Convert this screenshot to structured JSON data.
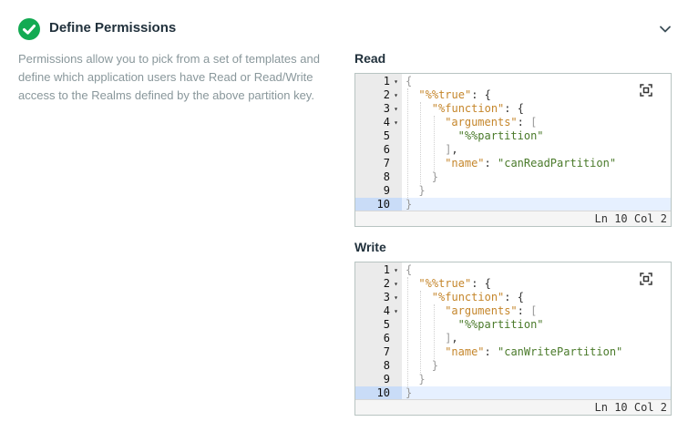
{
  "header": {
    "title": "Define Permissions"
  },
  "description": "Permissions allow you to pick from a set of templates and define which application users have Read or Read/Write access to the Realms defined by the above partition key.",
  "read": {
    "label": "Read",
    "status": "Ln 10 Col 2",
    "lines": [
      {
        "n": "1",
        "fold": true,
        "tokens": [
          [
            "p",
            "{"
          ]
        ]
      },
      {
        "n": "2",
        "fold": true,
        "tokens": [
          [
            "k",
            "\"%%true\""
          ],
          [
            "t",
            ": {"
          ]
        ]
      },
      {
        "n": "3",
        "fold": true,
        "tokens": [
          [
            "k",
            "\"%function\""
          ],
          [
            "t",
            ": {"
          ]
        ]
      },
      {
        "n": "4",
        "fold": true,
        "tokens": [
          [
            "k",
            "\"arguments\""
          ],
          [
            "t",
            ": "
          ],
          [
            "p",
            "["
          ]
        ]
      },
      {
        "n": "5",
        "fold": false,
        "tokens": [
          [
            "s",
            "\"%%partition\""
          ]
        ]
      },
      {
        "n": "6",
        "fold": false,
        "tokens": [
          [
            "p",
            "]"
          ],
          [
            "t",
            ","
          ]
        ]
      },
      {
        "n": "7",
        "fold": false,
        "tokens": [
          [
            "k",
            "\"name\""
          ],
          [
            "t",
            ": "
          ],
          [
            "s",
            "\"canReadPartition\""
          ]
        ]
      },
      {
        "n": "8",
        "fold": false,
        "tokens": [
          [
            "p",
            "}"
          ]
        ]
      },
      {
        "n": "9",
        "fold": false,
        "tokens": [
          [
            "p",
            "}"
          ]
        ]
      },
      {
        "n": "10",
        "fold": false,
        "tokens": [
          [
            "p",
            "}"
          ]
        ]
      }
    ]
  },
  "write": {
    "label": "Write",
    "status": "Ln 10 Col 2",
    "lines": [
      {
        "n": "1",
        "fold": true,
        "tokens": [
          [
            "p",
            "{"
          ]
        ]
      },
      {
        "n": "2",
        "fold": true,
        "tokens": [
          [
            "k",
            "\"%%true\""
          ],
          [
            "t",
            ": {"
          ]
        ]
      },
      {
        "n": "3",
        "fold": true,
        "tokens": [
          [
            "k",
            "\"%function\""
          ],
          [
            "t",
            ": {"
          ]
        ]
      },
      {
        "n": "4",
        "fold": true,
        "tokens": [
          [
            "k",
            "\"arguments\""
          ],
          [
            "t",
            ": "
          ],
          [
            "p",
            "["
          ]
        ]
      },
      {
        "n": "5",
        "fold": false,
        "tokens": [
          [
            "s",
            "\"%%partition\""
          ]
        ]
      },
      {
        "n": "6",
        "fold": false,
        "tokens": [
          [
            "p",
            "]"
          ],
          [
            "t",
            ","
          ]
        ]
      },
      {
        "n": "7",
        "fold": false,
        "tokens": [
          [
            "k",
            "\"name\""
          ],
          [
            "t",
            ": "
          ],
          [
            "s",
            "\"canWritePartition\""
          ]
        ]
      },
      {
        "n": "8",
        "fold": false,
        "tokens": [
          [
            "p",
            "}"
          ]
        ]
      },
      {
        "n": "9",
        "fold": false,
        "tokens": [
          [
            "p",
            "}"
          ]
        ]
      },
      {
        "n": "10",
        "fold": false,
        "tokens": [
          [
            "p",
            "}"
          ]
        ]
      }
    ]
  }
}
